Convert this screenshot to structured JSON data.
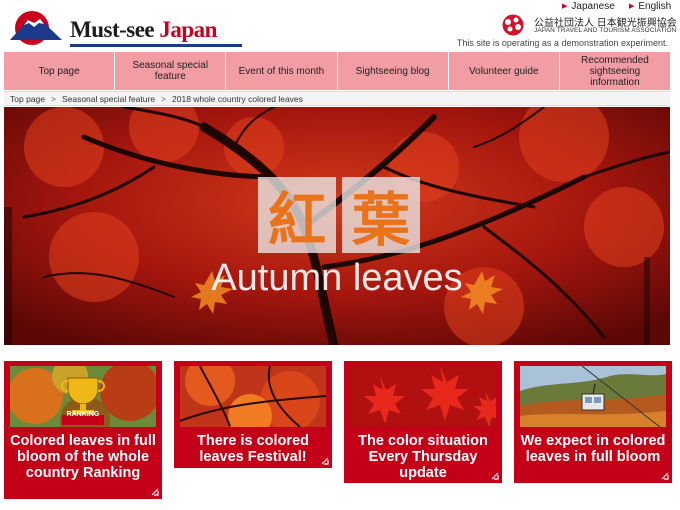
{
  "header": {
    "logo_text_a": "Must-see ",
    "logo_text_b": "Japan",
    "lang_japanese": "Japanese",
    "lang_english": "English",
    "org_name_ja": "公益社団法人 日本観光振興協会",
    "org_name_en": "JAPAN TRAVEL AND TOURISM ASSOCIATION",
    "demo_notice": "This site is operating as a demonstration experiment."
  },
  "nav": {
    "items": [
      {
        "label": "Top page"
      },
      {
        "label": "Seasonal special feature"
      },
      {
        "label": "Event of this month"
      },
      {
        "label": "Sightseeing blog"
      },
      {
        "label": "Volunteer guide"
      },
      {
        "label": "Recommended sightseeing information"
      }
    ]
  },
  "breadcrumb": {
    "items": [
      "Top page",
      "Seasonal special feature",
      "2018 whole country colored leaves"
    ],
    "separator": ">"
  },
  "hero": {
    "kanji_1": "紅",
    "kanji_2": "葉",
    "subtitle": "Autumn leaves"
  },
  "cards": [
    {
      "title": "Colored leaves in full bloom of the whole country Ranking",
      "badge": "RANKING"
    },
    {
      "title": "There is colored leaves Festival!"
    },
    {
      "title": "The color situation Every Thursday update"
    },
    {
      "title": "We expect in colored leaves in full bloom"
    }
  ],
  "colors": {
    "brand_red": "#c8001e",
    "card_red": "#c40018",
    "nav_pink": "#f29ca4",
    "logo_blue": "#1e3a8a"
  }
}
